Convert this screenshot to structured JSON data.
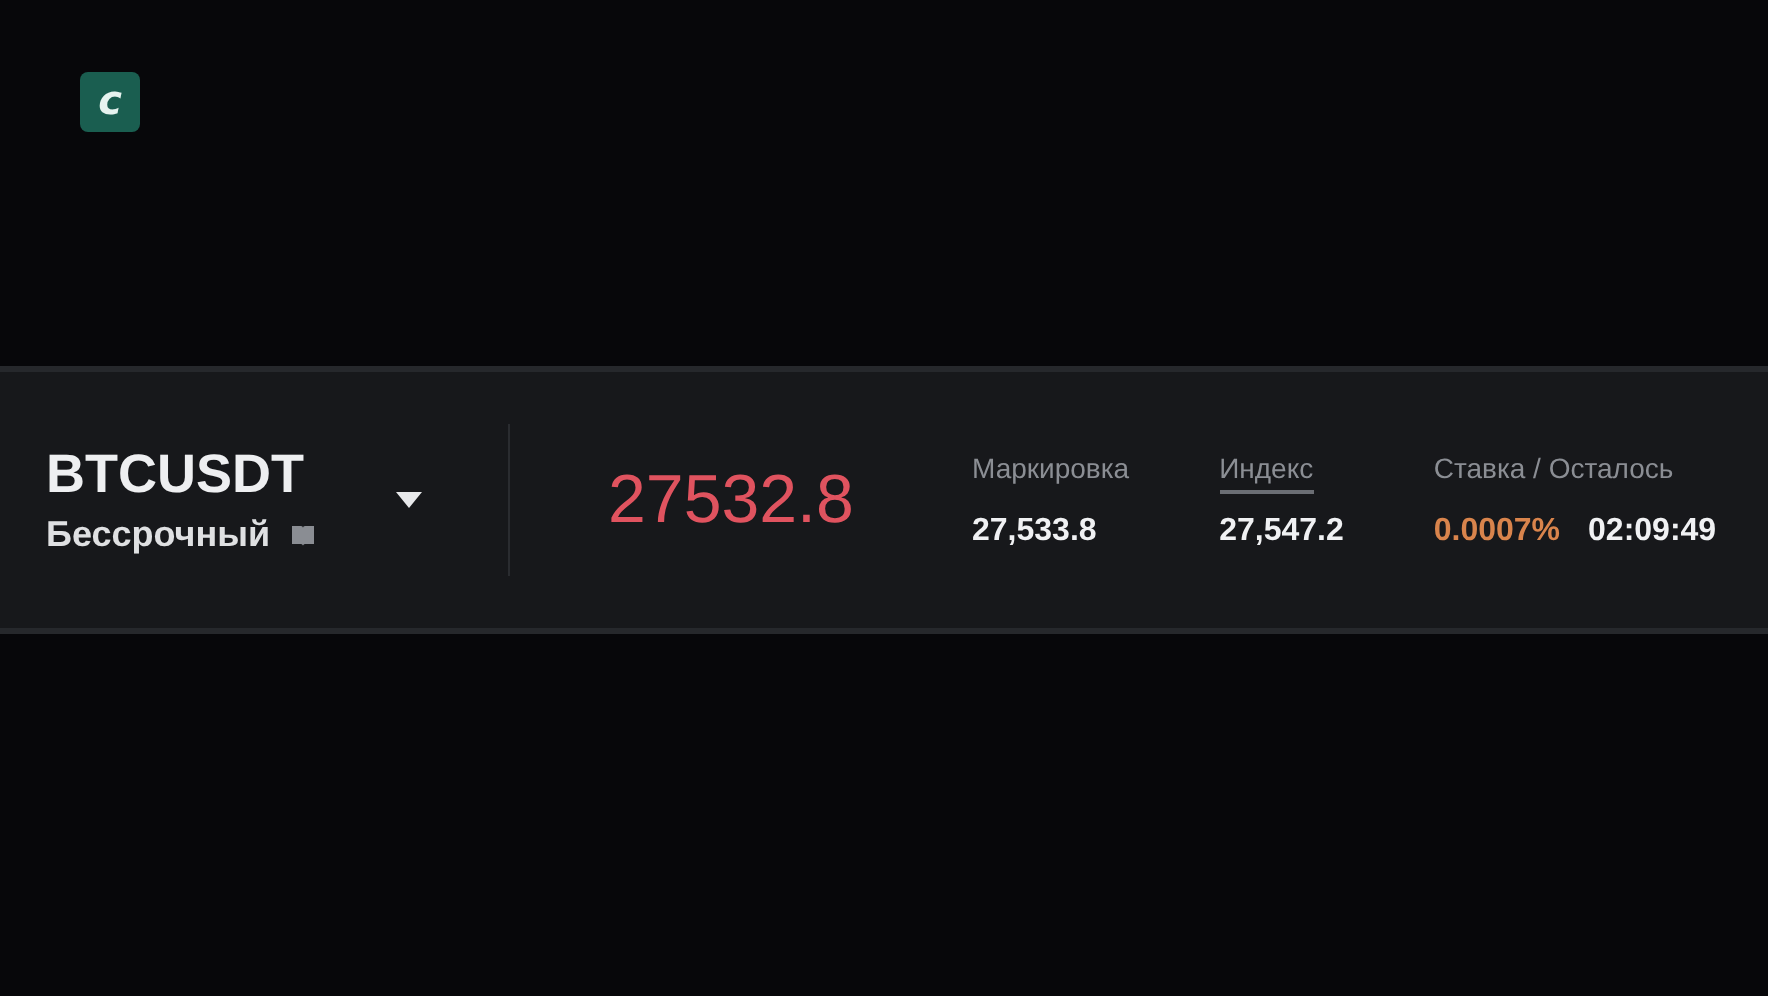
{
  "logo": {
    "letter": "c"
  },
  "ticker": {
    "symbol": "BTCUSDT",
    "type": "Бессрочный",
    "price": "27532.8",
    "falling": true
  },
  "stats": [
    {
      "label": "Маркировка",
      "underlined": false,
      "values": [
        {
          "text": "27,533.8",
          "kind": "plain"
        }
      ]
    },
    {
      "label": "Индекс",
      "underlined": true,
      "values": [
        {
          "text": "27,547.2",
          "kind": "plain"
        }
      ]
    },
    {
      "label": "Ставка / Осталось",
      "underlined": false,
      "values": [
        {
          "text": "0.0007%",
          "kind": "rate"
        },
        {
          "text": "02:09:49",
          "kind": "plain"
        }
      ]
    }
  ]
}
